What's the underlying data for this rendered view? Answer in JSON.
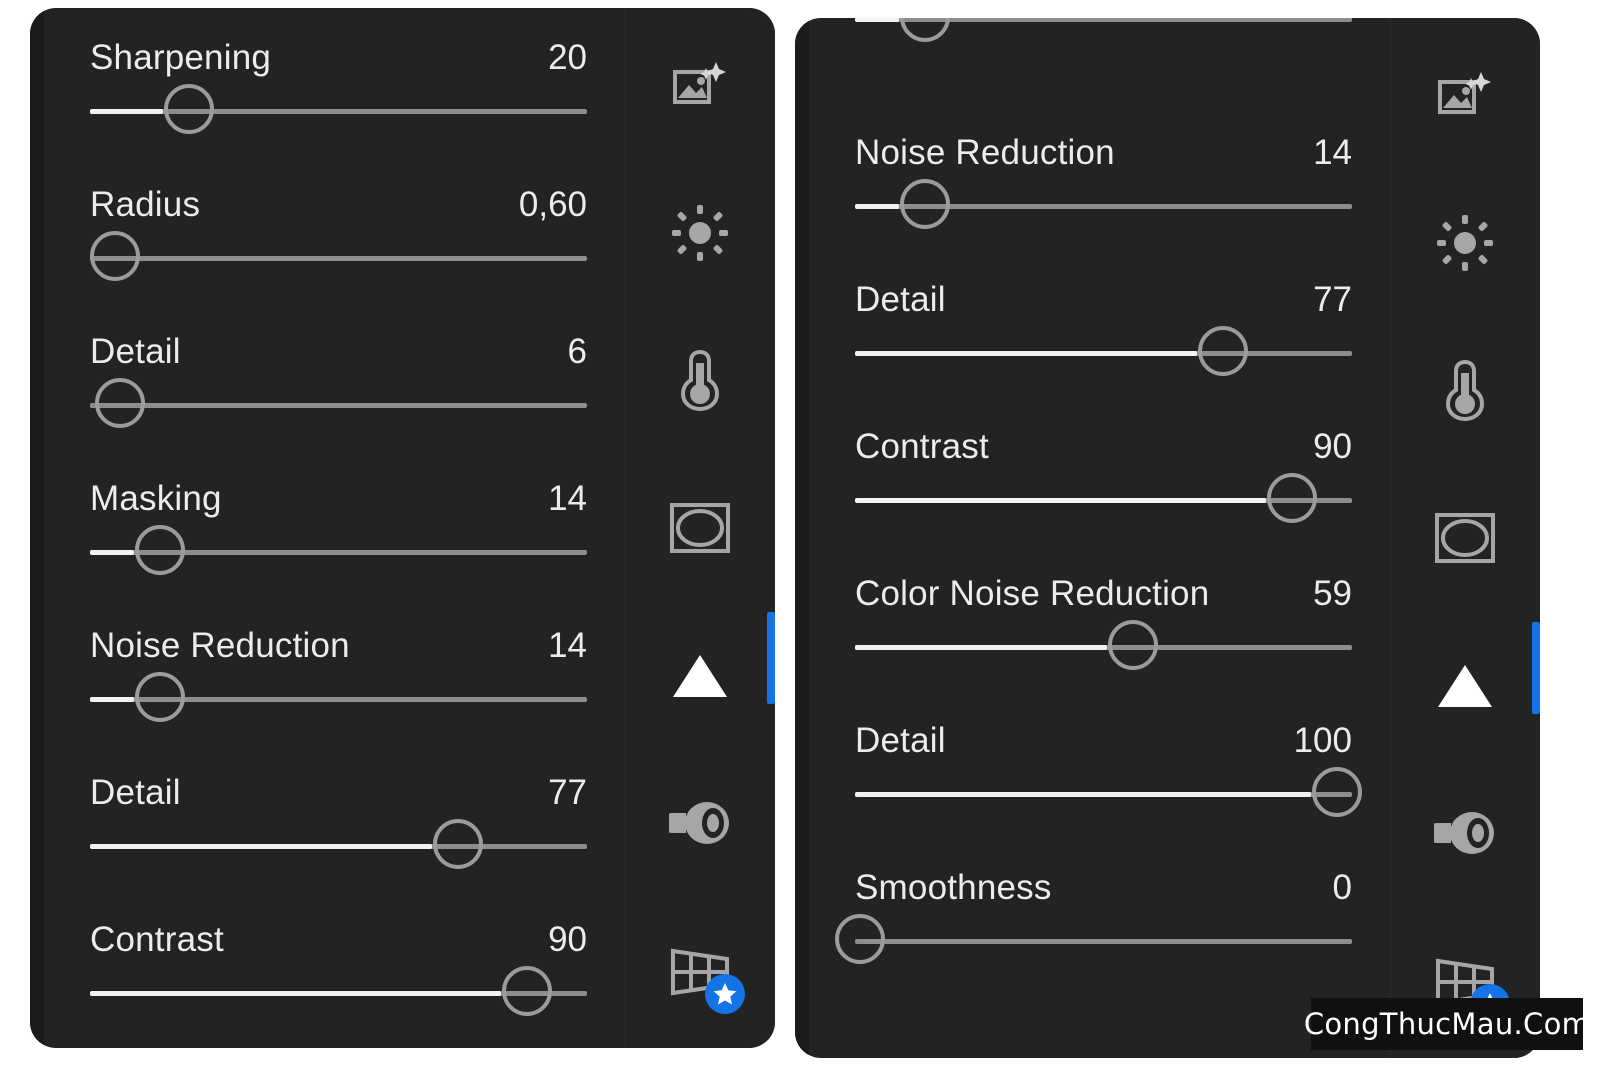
{
  "app": {
    "theme_background": "#232323",
    "accent_color": "#1473e6",
    "text_color": "#ececec",
    "track_color": "#8d8d8d",
    "track_fill_color": "#f2f2f2"
  },
  "panels": [
    {
      "id": "left-panel",
      "name": "sharpening-panel",
      "clipped_top": false,
      "sliders": [
        {
          "label": "Sharpening",
          "value": "20",
          "percent": 20,
          "style": "nub"
        },
        {
          "label": "Radius",
          "value": "0,60",
          "percent": 5,
          "style": "start"
        },
        {
          "label": "Detail",
          "value": "6",
          "percent": 6,
          "style": "start"
        },
        {
          "label": "Masking",
          "value": "14",
          "percent": 14,
          "style": "nub"
        },
        {
          "label": "Noise Reduction",
          "value": "14",
          "percent": 14,
          "style": "nub"
        },
        {
          "label": "Detail",
          "value": "77",
          "percent": 74,
          "style": "fill"
        },
        {
          "label": "Contrast",
          "value": "90",
          "percent": 88,
          "style": "fill-tail"
        }
      ]
    },
    {
      "id": "right-panel",
      "name": "noise-reduction-panel",
      "clipped_top": true,
      "sliders": [
        {
          "label": "",
          "value": "",
          "percent": 14,
          "style": "nub"
        },
        {
          "label": "Noise Reduction",
          "value": "14",
          "percent": 14,
          "style": "nub"
        },
        {
          "label": "Detail",
          "value": "77",
          "percent": 74,
          "style": "fill"
        },
        {
          "label": "Contrast",
          "value": "90",
          "percent": 88,
          "style": "fill-tail"
        },
        {
          "label": "Color Noise Reduction",
          "value": "59",
          "percent": 56,
          "style": "fill"
        },
        {
          "label": "Detail",
          "value": "100",
          "percent": 97,
          "style": "fill"
        },
        {
          "label": "Smoothness",
          "value": "0",
          "percent": 1,
          "style": "start"
        }
      ]
    }
  ],
  "rail": {
    "items": [
      {
        "icon": "image-sparkle-icon",
        "label": "Auto Enhance",
        "active": false,
        "badge": false
      },
      {
        "icon": "sun-icon",
        "label": "Light",
        "active": false,
        "badge": false
      },
      {
        "icon": "thermometer-icon",
        "label": "Color",
        "active": false,
        "badge": false
      },
      {
        "icon": "vignette-icon",
        "label": "Effects",
        "active": false,
        "badge": false
      },
      {
        "icon": "triangle-icon",
        "label": "Detail",
        "active": true,
        "badge": false
      },
      {
        "icon": "lens-icon",
        "label": "Optics",
        "active": false,
        "badge": false
      },
      {
        "icon": "perspective-grid-icon",
        "label": "Geometry",
        "active": false,
        "badge": true,
        "badge_icon": "star-icon"
      }
    ]
  },
  "watermark": {
    "text": "CongThucMau.Com"
  }
}
